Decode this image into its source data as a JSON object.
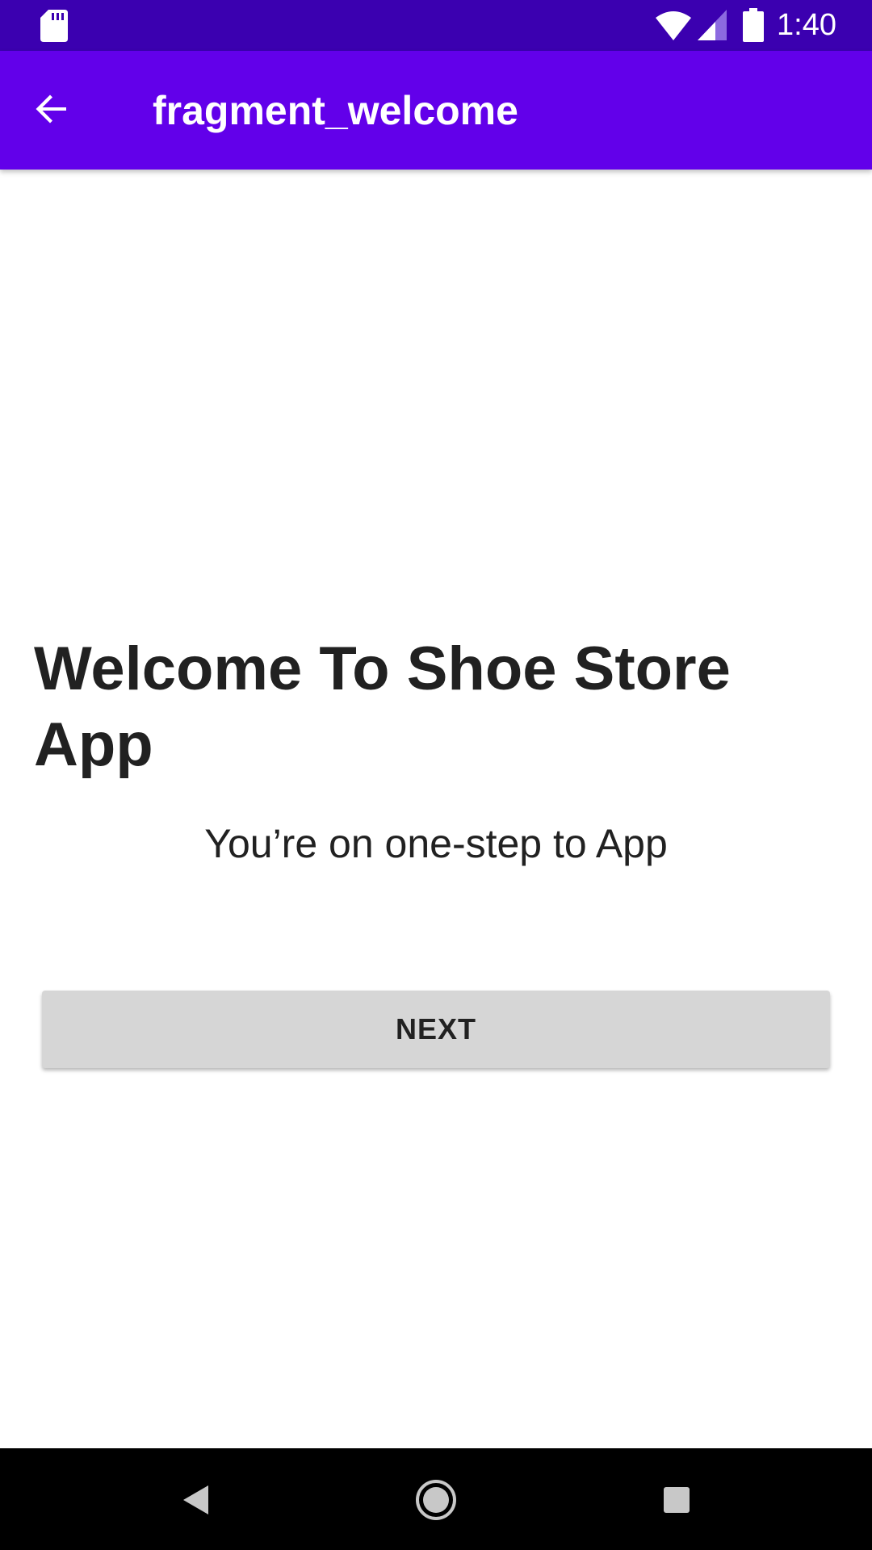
{
  "status_bar": {
    "time": "1:40",
    "icons": [
      "sd-card-icon",
      "wifi-icon",
      "cell-signal-icon",
      "battery-icon"
    ]
  },
  "app_bar": {
    "title": "fragment_welcome",
    "back_icon": "arrow-back-icon"
  },
  "welcome": {
    "headline": "Welcome To Shoe Store App",
    "subtitle": "You’re on one-step to App",
    "next_button_label": "NEXT"
  },
  "nav_bar": {
    "buttons": [
      "back-triangle-icon",
      "home-circle-icon",
      "recents-square-icon"
    ]
  },
  "colors": {
    "status_bar": "#3b00b0",
    "app_bar": "#6200ea",
    "button_bg": "#d6d6d6",
    "text": "#212121"
  }
}
